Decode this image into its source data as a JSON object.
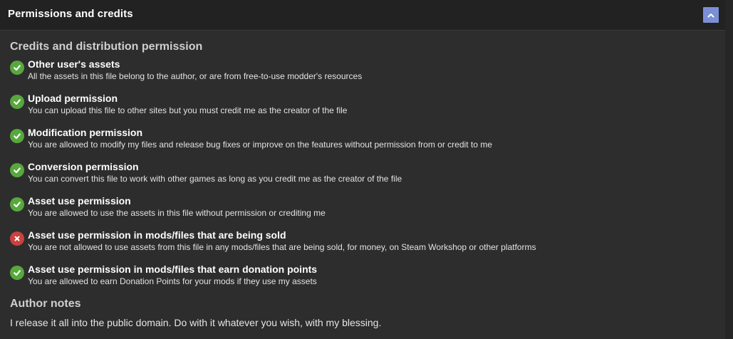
{
  "header": {
    "title": "Permissions and credits",
    "collapse_icon": "chevron-up-icon",
    "collapse_color": "#7b8fd6"
  },
  "credits_section": {
    "title": "Credits and distribution permission"
  },
  "permissions": [
    {
      "status": "allowed",
      "icon": "check-icon",
      "title": "Other user's assets",
      "description": "All the assets in this file belong to the author, or are from free-to-use modder's resources"
    },
    {
      "status": "allowed",
      "icon": "check-icon",
      "title": "Upload permission",
      "description": "You can upload this file to other sites but you must credit me as the creator of the file"
    },
    {
      "status": "allowed",
      "icon": "check-icon",
      "title": "Modification permission",
      "description": "You are allowed to modify my files and release bug fixes or improve on the features without permission from or credit to me"
    },
    {
      "status": "allowed",
      "icon": "check-icon",
      "title": "Conversion permission",
      "description": "You can convert this file to work with other games as long as you credit me as the creator of the file"
    },
    {
      "status": "allowed",
      "icon": "check-icon",
      "title": "Asset use permission",
      "description": "You are allowed to use the assets in this file without permission or crediting me"
    },
    {
      "status": "denied",
      "icon": "cross-icon",
      "title": "Asset use permission in mods/files that are being sold",
      "description": "You are not allowed to use assets from this file in any mods/files that are being sold, for money, on Steam Workshop or other platforms"
    },
    {
      "status": "allowed",
      "icon": "check-icon",
      "title": "Asset use permission in mods/files that earn donation points",
      "description": "You are allowed to earn Donation Points for your mods if they use my assets"
    }
  ],
  "author_notes": {
    "title": "Author notes",
    "text": "I release it all into the public domain. Do with it whatever you wish, with my blessing."
  },
  "colors": {
    "allowed": "#57a83d",
    "denied": "#c9423f",
    "background": "#2d2d2d",
    "header_background": "#222222"
  }
}
